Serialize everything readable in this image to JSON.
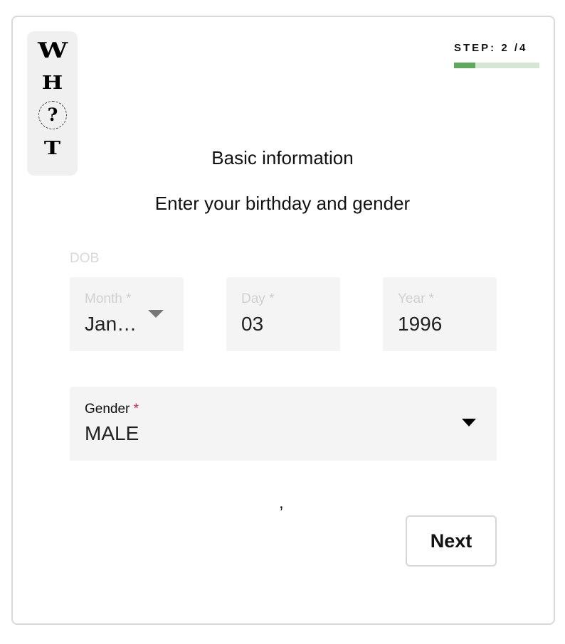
{
  "logo": {
    "letters": [
      "W",
      "H",
      "?",
      "T"
    ]
  },
  "step": {
    "text": "STEP: 2 /4",
    "progress_fraction": 0.25,
    "accent_color": "#5fa95f",
    "track_color": "#d4e6d4"
  },
  "heading": {
    "title": "Basic information",
    "subtitle": "Enter your birthday and gender"
  },
  "dob": {
    "label": "DOB",
    "month": {
      "label": "Month *",
      "value": "January",
      "icon": "chevron-down-icon"
    },
    "day": {
      "label": "Day *",
      "value": "03"
    },
    "year": {
      "label": "Year *",
      "value": "1996"
    }
  },
  "gender": {
    "label": "Gender",
    "required_mark": "*",
    "value": "MALE",
    "icon": "chevron-down-icon",
    "required_color": "#d81b60"
  },
  "stray_text": ",",
  "actions": {
    "next_label": "Next"
  }
}
